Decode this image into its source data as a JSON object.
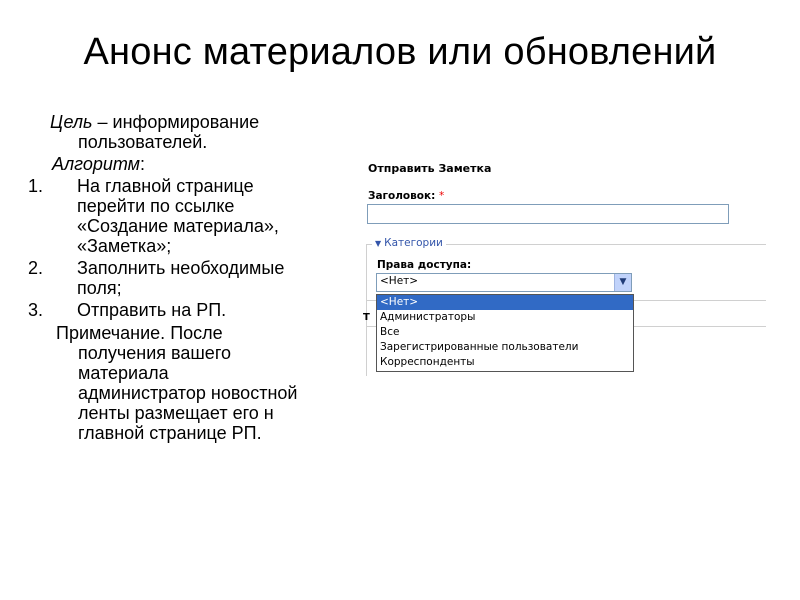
{
  "slide": {
    "title": "Анонс материалов или обновлений"
  },
  "content": {
    "goal_label": "Цель",
    "goal_rest_line1": " – информирование",
    "goal_line2": "пользователей.",
    "algo_label": "Алгоритм",
    "algo_suffix": ":",
    "steps": [
      {
        "num": "1.",
        "lines": [
          "На главной странице",
          "перейти по ссылке",
          "«Создание материала»,",
          "«Заметка»;"
        ]
      },
      {
        "num": "2.",
        "lines": [
          "Заполнить необходимые",
          "поля;"
        ]
      },
      {
        "num": "3.",
        "lines": [
          "Отправить на РП."
        ]
      }
    ],
    "note_lines": [
      "Примечание. После",
      "получения вашего",
      "материала",
      "администратор новостной",
      "ленты размещает его н",
      "главной странице РП."
    ]
  },
  "form": {
    "heading": "Отправить Заметка",
    "title_label": "Заголовок:",
    "required_mark": "*",
    "title_value": "",
    "fieldset_legend": "Категории",
    "access_label": "Права доступа:",
    "selected_value": "<Нет>",
    "side_letter": "Т",
    "options": [
      "<Нет>",
      "Администраторы",
      "Все",
      "Зарегистрированные пользователи",
      "Корреспонденты"
    ],
    "selected_index": 0
  },
  "colors": {
    "selected_bg": "#316ac5",
    "legend": "#3355aa",
    "required": "#e00000"
  }
}
